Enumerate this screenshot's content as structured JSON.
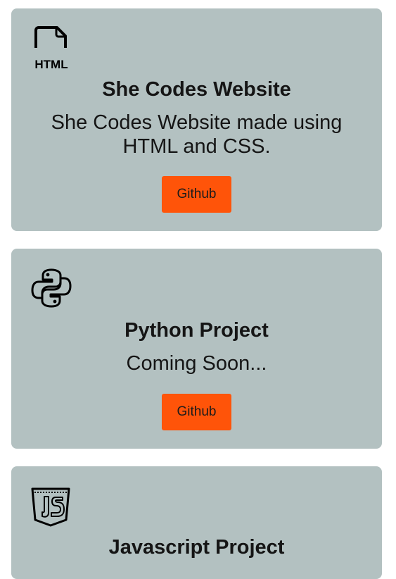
{
  "projects": [
    {
      "icon": "html-file-icon",
      "title": "She Codes Website",
      "description": "She Codes Website made using HTML and CSS.",
      "button_label": "Github"
    },
    {
      "icon": "python-icon",
      "title": "Python Project",
      "description": "Coming Soon...",
      "button_label": "Github"
    },
    {
      "icon": "javascript-icon",
      "title": "Javascript Project"
    }
  ],
  "colors": {
    "card_background": "#b3c1c1",
    "button_background": "#ff5409",
    "text": "#151515"
  }
}
